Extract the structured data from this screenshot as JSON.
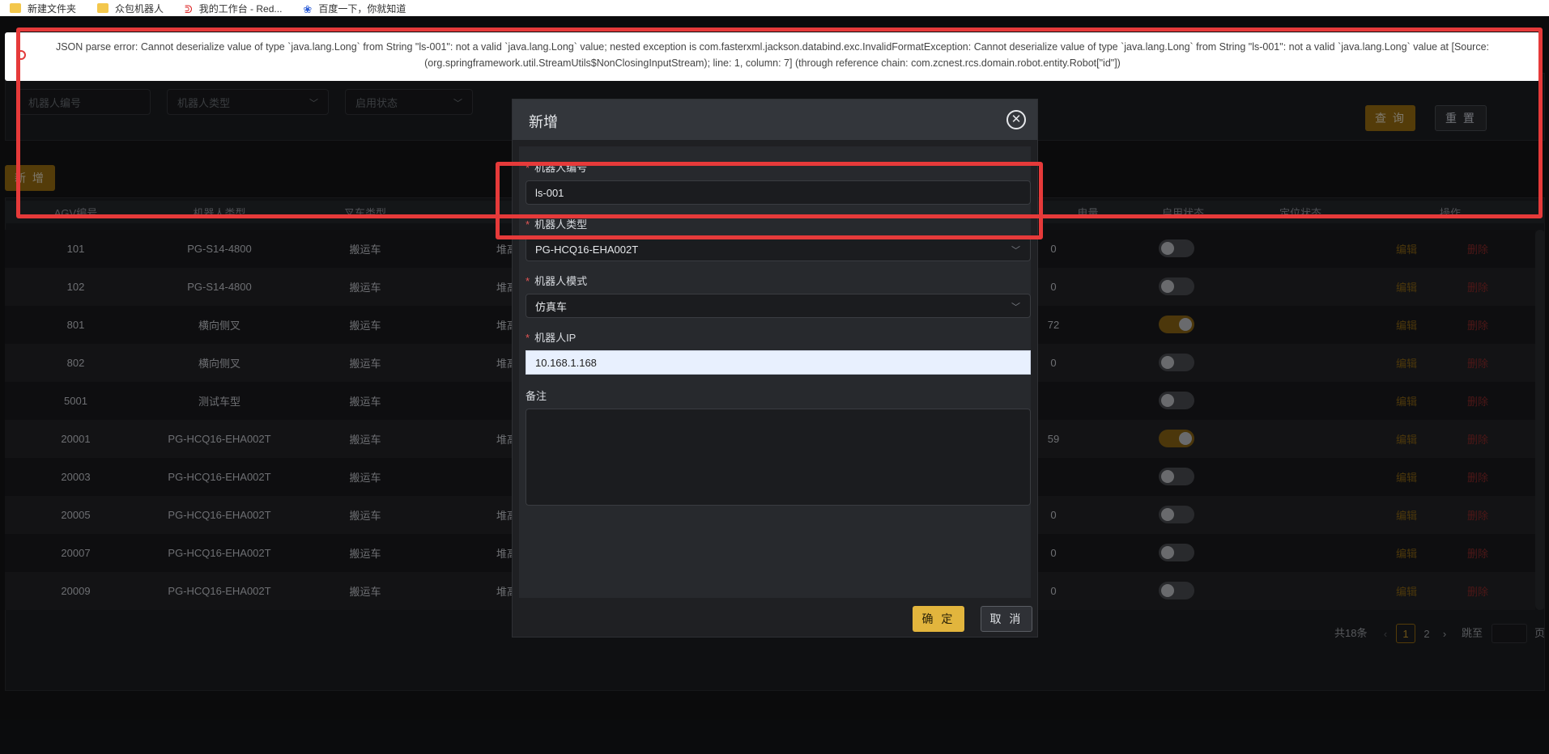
{
  "bookmarks": [
    {
      "label": "新建文件夹",
      "icon": "folder-icon"
    },
    {
      "label": "众包机器人",
      "icon": "folder-icon"
    },
    {
      "label": "我的工作台 - Red...",
      "icon": "redmine-icon"
    },
    {
      "label": "百度一下，你就知道",
      "icon": "baidu-icon"
    }
  ],
  "search": {
    "robot_no_placeholder": "机器人编号",
    "robot_type_placeholder": "机器人类型",
    "enable_status_placeholder": "启用状态",
    "query_label": "查 询",
    "reset_label": "重 置"
  },
  "toolbar": {
    "add_label": "新 增"
  },
  "table": {
    "headers": [
      "AGV编号",
      "机器人类型",
      "叉车类型",
      "",
      "电量",
      "启用状态",
      "定位状态",
      "操作"
    ],
    "rows": [
      {
        "agv": "101",
        "type": "PG-S14-4800",
        "fork": "搬运车",
        "col4": "堆高",
        "battery": "0",
        "enabled": false
      },
      {
        "agv": "102",
        "type": "PG-S14-4800",
        "fork": "搬运车",
        "col4": "堆高",
        "battery": "0",
        "enabled": false
      },
      {
        "agv": "801",
        "type": "横向侧叉",
        "fork": "搬运车",
        "col4": "堆高",
        "battery": "72",
        "enabled": true
      },
      {
        "agv": "802",
        "type": "横向侧叉",
        "fork": "搬运车",
        "col4": "堆高",
        "battery": "0",
        "enabled": false
      },
      {
        "agv": "5001",
        "type": "测试车型",
        "fork": "搬运车",
        "col4": "",
        "battery": "",
        "enabled": false
      },
      {
        "agv": "20001",
        "type": "PG-HCQ16-EHA002T",
        "fork": "搬运车",
        "col4": "堆高",
        "battery": "59",
        "enabled": true
      },
      {
        "agv": "20003",
        "type": "PG-HCQ16-EHA002T",
        "fork": "搬运车",
        "col4": "",
        "battery": "",
        "enabled": false
      },
      {
        "agv": "20005",
        "type": "PG-HCQ16-EHA002T",
        "fork": "搬运车",
        "col4": "堆高",
        "battery": "0",
        "enabled": false
      },
      {
        "agv": "20007",
        "type": "PG-HCQ16-EHA002T",
        "fork": "搬运车",
        "col4": "堆高",
        "battery": "0",
        "enabled": false
      },
      {
        "agv": "20009",
        "type": "PG-HCQ16-EHA002T",
        "fork": "搬运车",
        "col4": "堆高",
        "battery": "0",
        "enabled": false
      }
    ],
    "edit_label": "编辑",
    "delete_label": "删除"
  },
  "pagination": {
    "total": "共18条",
    "prev": "‹",
    "page1": "1",
    "page2": "2",
    "next": "›",
    "jump_to": "跳至",
    "page_suffix": "页"
  },
  "dialog": {
    "title": "新增",
    "fields": {
      "robot_no": {
        "label": "机器人编号",
        "value": "ls-001"
      },
      "robot_type": {
        "label": "机器人类型",
        "value": "PG-HCQ16-EHA002T"
      },
      "robot_mode": {
        "label": "机器人模式",
        "value": "仿真车"
      },
      "robot_ip": {
        "label": "机器人IP",
        "value": "10.168.1.168"
      },
      "remark": {
        "label": "备注",
        "value": ""
      }
    },
    "confirm_label": "确 定",
    "cancel_label": "取 消"
  },
  "error": {
    "message": "JSON parse error: Cannot deserialize value of type `java.lang.Long` from String \"ls-001\": not a valid `java.lang.Long` value; nested exception is com.fasterxml.jackson.databind.exc.InvalidFormatException: Cannot deserialize value of type `java.lang.Long` from String \"ls-001\": not a valid `java.lang.Long` value at [Source: (org.springframework.util.StreamUtils$NonClosingInputStream); line: 1, column: 7] (through reference chain: com.zcnest.rcs.domain.robot.entity.Robot[\"id\"])"
  },
  "colors": {
    "accent_gold": "#9a6e12",
    "annotation_red": "#e63a3a",
    "toggle_on": "#8a6515"
  }
}
